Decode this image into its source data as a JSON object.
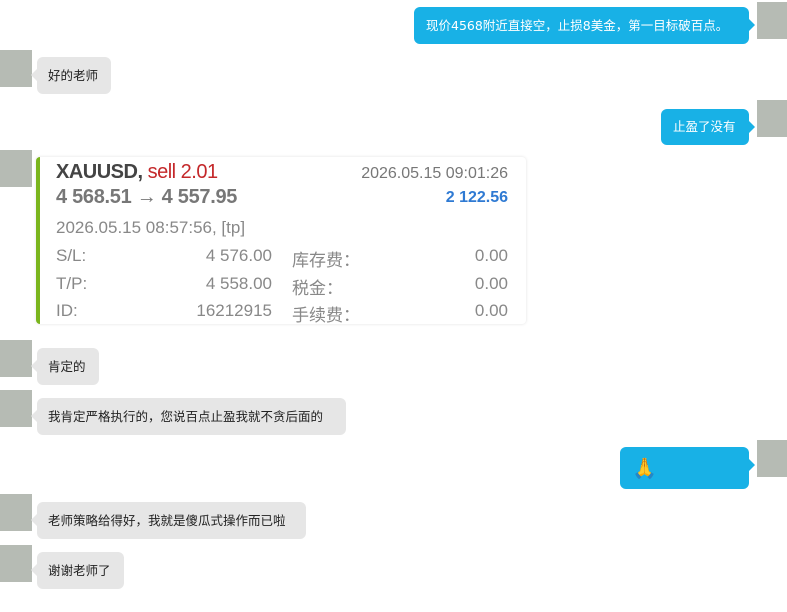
{
  "messages": [
    {
      "side": "right",
      "text": "现价4568附近直接空，止损8美金，第一目标破百点。"
    },
    {
      "side": "left",
      "text": "好的老师"
    },
    {
      "side": "right",
      "text": "止盈了没有"
    },
    {
      "side": "left",
      "text": "肯定的"
    },
    {
      "side": "left",
      "text": "我肯定严格执行的，您说百点止盈我就不贪后面的"
    },
    {
      "side": "right",
      "text": "🙏"
    },
    {
      "side": "left",
      "text": "老师策略给得好，我就是傻瓜式操作而已啦"
    },
    {
      "side": "left",
      "text": "谢谢老师了"
    }
  ],
  "trade": {
    "symbol": "XAUUSD,",
    "action": "sell 2.01",
    "close_time": "2026.05.15 09:01:26",
    "prices": "4 568.51 → 4 557.95",
    "profit": "2 122.56",
    "open_info": "2026.05.15 08:57:56, [tp]",
    "rows": [
      {
        "label": "S/L:",
        "value": "4 576.00",
        "label2": "库存费：",
        "value2": "0.00"
      },
      {
        "label": "T/P:",
        "value": "4 558.00",
        "label2": "税金：",
        "value2": "0.00"
      },
      {
        "label": "ID:",
        "value": "16212915",
        "label2": "手续费：",
        "value2": "0.00"
      }
    ]
  },
  "colors": {
    "bubble_right": "#18b1e6",
    "bubble_left": "#e6e6e6",
    "accent_bar": "#7ab51d",
    "sell": "#c4282a",
    "profit": "#2f7ad3"
  }
}
